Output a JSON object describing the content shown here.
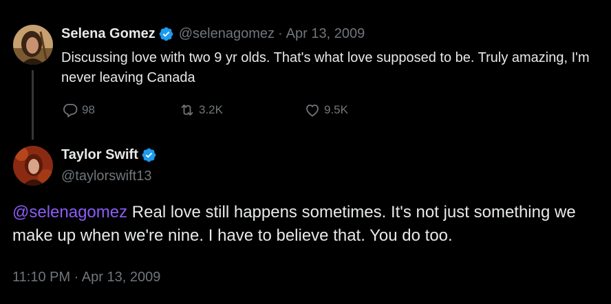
{
  "reply_tweet": {
    "author_name": "Selena Gomez",
    "handle": "@selenagomez",
    "separator": "·",
    "date": "Apr 13, 2009",
    "text": "Discussing love with two 9 yr olds. That's what love supposed to be. Truly amazing, I'm never leaving Canada",
    "replies": "98",
    "retweets": "3.2K",
    "likes": "9.5K",
    "avatar_icon": "avatar-selena",
    "verified_icon": "verified-badge-icon"
  },
  "main_tweet": {
    "author_name": "Taylor Swift",
    "handle": "@taylorswift13",
    "mention": "@selenagomez",
    "text": " Real love still happens sometimes. It's not just something we make up when we're nine. I have to believe that. You do too.",
    "timestamp": "11:10 PM · Apr 13, 2009",
    "avatar_icon": "avatar-taylor",
    "verified_icon": "verified-badge-icon"
  },
  "colors": {
    "background": "#000000",
    "text": "#e7e9ea",
    "secondary": "#71767b",
    "verified": "#1d9bf0",
    "mention": "#8b5cf6",
    "thread_line": "#333639"
  }
}
